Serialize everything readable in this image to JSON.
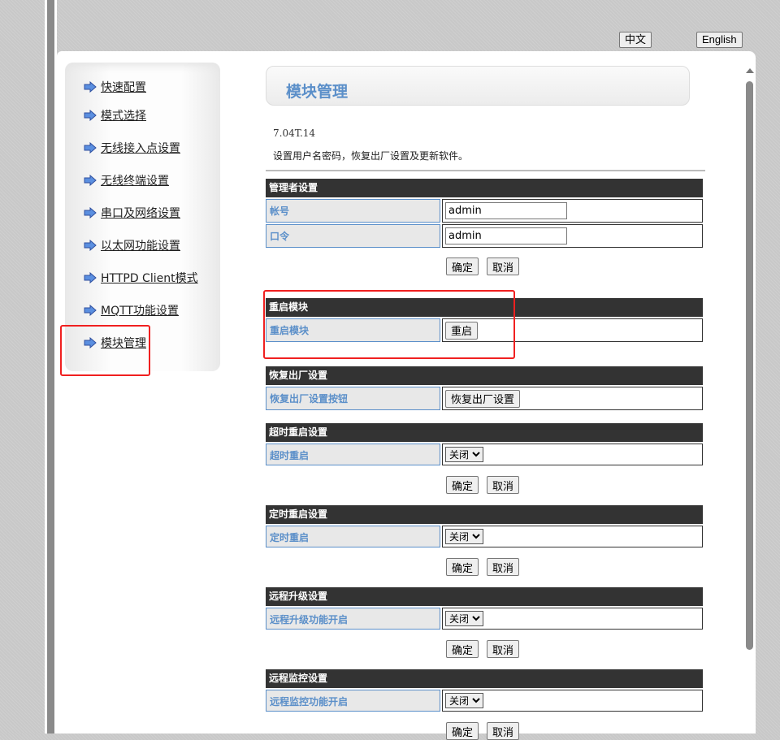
{
  "lang": {
    "zh": "中文",
    "en": "English"
  },
  "sidebar": {
    "items": [
      {
        "label": "快速配置"
      },
      {
        "label": "模式选择"
      },
      {
        "label": "无线接入点设置"
      },
      {
        "label": "无线终端设置"
      },
      {
        "label": "串口及网络设置"
      },
      {
        "label": "以太网功能设置"
      },
      {
        "label": "HTTPD Client模式"
      },
      {
        "label": "MQTT功能设置"
      },
      {
        "label": "模块管理"
      }
    ]
  },
  "main": {
    "title": "模块管理",
    "version": "7.04T.14",
    "description": "设置用户名密码，恢复出厂设置及更新软件。",
    "admin": {
      "header": "管理者设置",
      "user_label": "帐号",
      "user_value": "admin",
      "pass_label": "口令",
      "pass_value": "admin",
      "ok": "确定",
      "cancel": "取消"
    },
    "restart": {
      "header": "重启模块",
      "label": "重启模块",
      "button": "重启"
    },
    "factory": {
      "header": "恢复出厂设置",
      "label": "恢复出厂设置按钮",
      "button": "恢复出厂设置"
    },
    "timeout": {
      "header": "超时重启设置",
      "label": "超时重启",
      "value": "关闭",
      "ok": "确定",
      "cancel": "取消"
    },
    "timed": {
      "header": "定时重启设置",
      "label": "定时重启",
      "value": "关闭",
      "ok": "确定",
      "cancel": "取消"
    },
    "upgrade": {
      "header": "远程升级设置",
      "label": "远程升级功能开启",
      "value": "关闭",
      "ok": "确定",
      "cancel": "取消"
    },
    "monitor": {
      "header": "远程监控设置",
      "label": "远程监控功能开启",
      "value": "关闭",
      "ok": "确定",
      "cancel": "取消"
    }
  }
}
